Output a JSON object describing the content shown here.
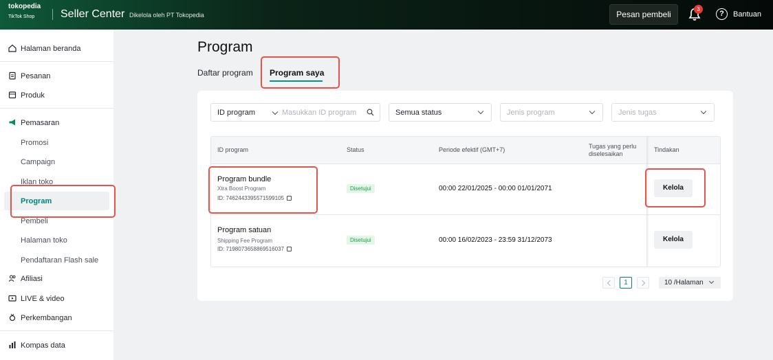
{
  "header": {
    "logo_top": "tokopedia",
    "logo_bottom": "TikTok Shop",
    "brand": "Seller Center",
    "managed_by": "Dikelola oleh PT Tokopedia",
    "buyer_message_label": "Pesan pembeli",
    "notification_count": "3",
    "help_label": "Bantuan"
  },
  "sidebar": {
    "home": "Halaman beranda",
    "orders": "Pesanan",
    "products": "Produk",
    "marketing": "Pemasaran",
    "marketing_items": [
      "Promosi",
      "Campaign",
      "Iklan toko",
      "Program",
      "Pembeli",
      "Halaman toko",
      "Pendaftaran Flash sale"
    ],
    "affiliate": "Afiliasi",
    "live_video": "LIVE & video",
    "growth": "Perkembangan",
    "data_compass": "Kompas data"
  },
  "main": {
    "title": "Program",
    "tabs": [
      "Daftar program",
      "Program saya"
    ],
    "filters": {
      "id_select": "ID program",
      "id_placeholder": "Masukkan ID program",
      "status": "Semua status",
      "program_type_placeholder": "Jenis program",
      "task_type_placeholder": "Jenis tugas"
    },
    "table": {
      "columns": [
        "ID program",
        "Status",
        "Periode efektif (GMT+7)",
        "Tugas yang perlu diselesaikan",
        "Tindakan"
      ],
      "rows": [
        {
          "name": "Program bundle",
          "type": "Xtra Boost Program",
          "id": "ID: 7462443395571599105",
          "status": "Disetujui",
          "period": "00:00 22/01/2025 - 00:00 01/01/2071",
          "action": "Kelola"
        },
        {
          "name": "Program satuan",
          "type": "Shipping Fee Program",
          "id": "ID: 7198073658869516037",
          "status": "Disetujui",
          "period": "00:00 16/02/2023 - 23:59 31/12/2073",
          "action": "Kelola"
        }
      ]
    },
    "pagination": {
      "current_page": "1",
      "per_page": "10 /Halaman"
    }
  }
}
